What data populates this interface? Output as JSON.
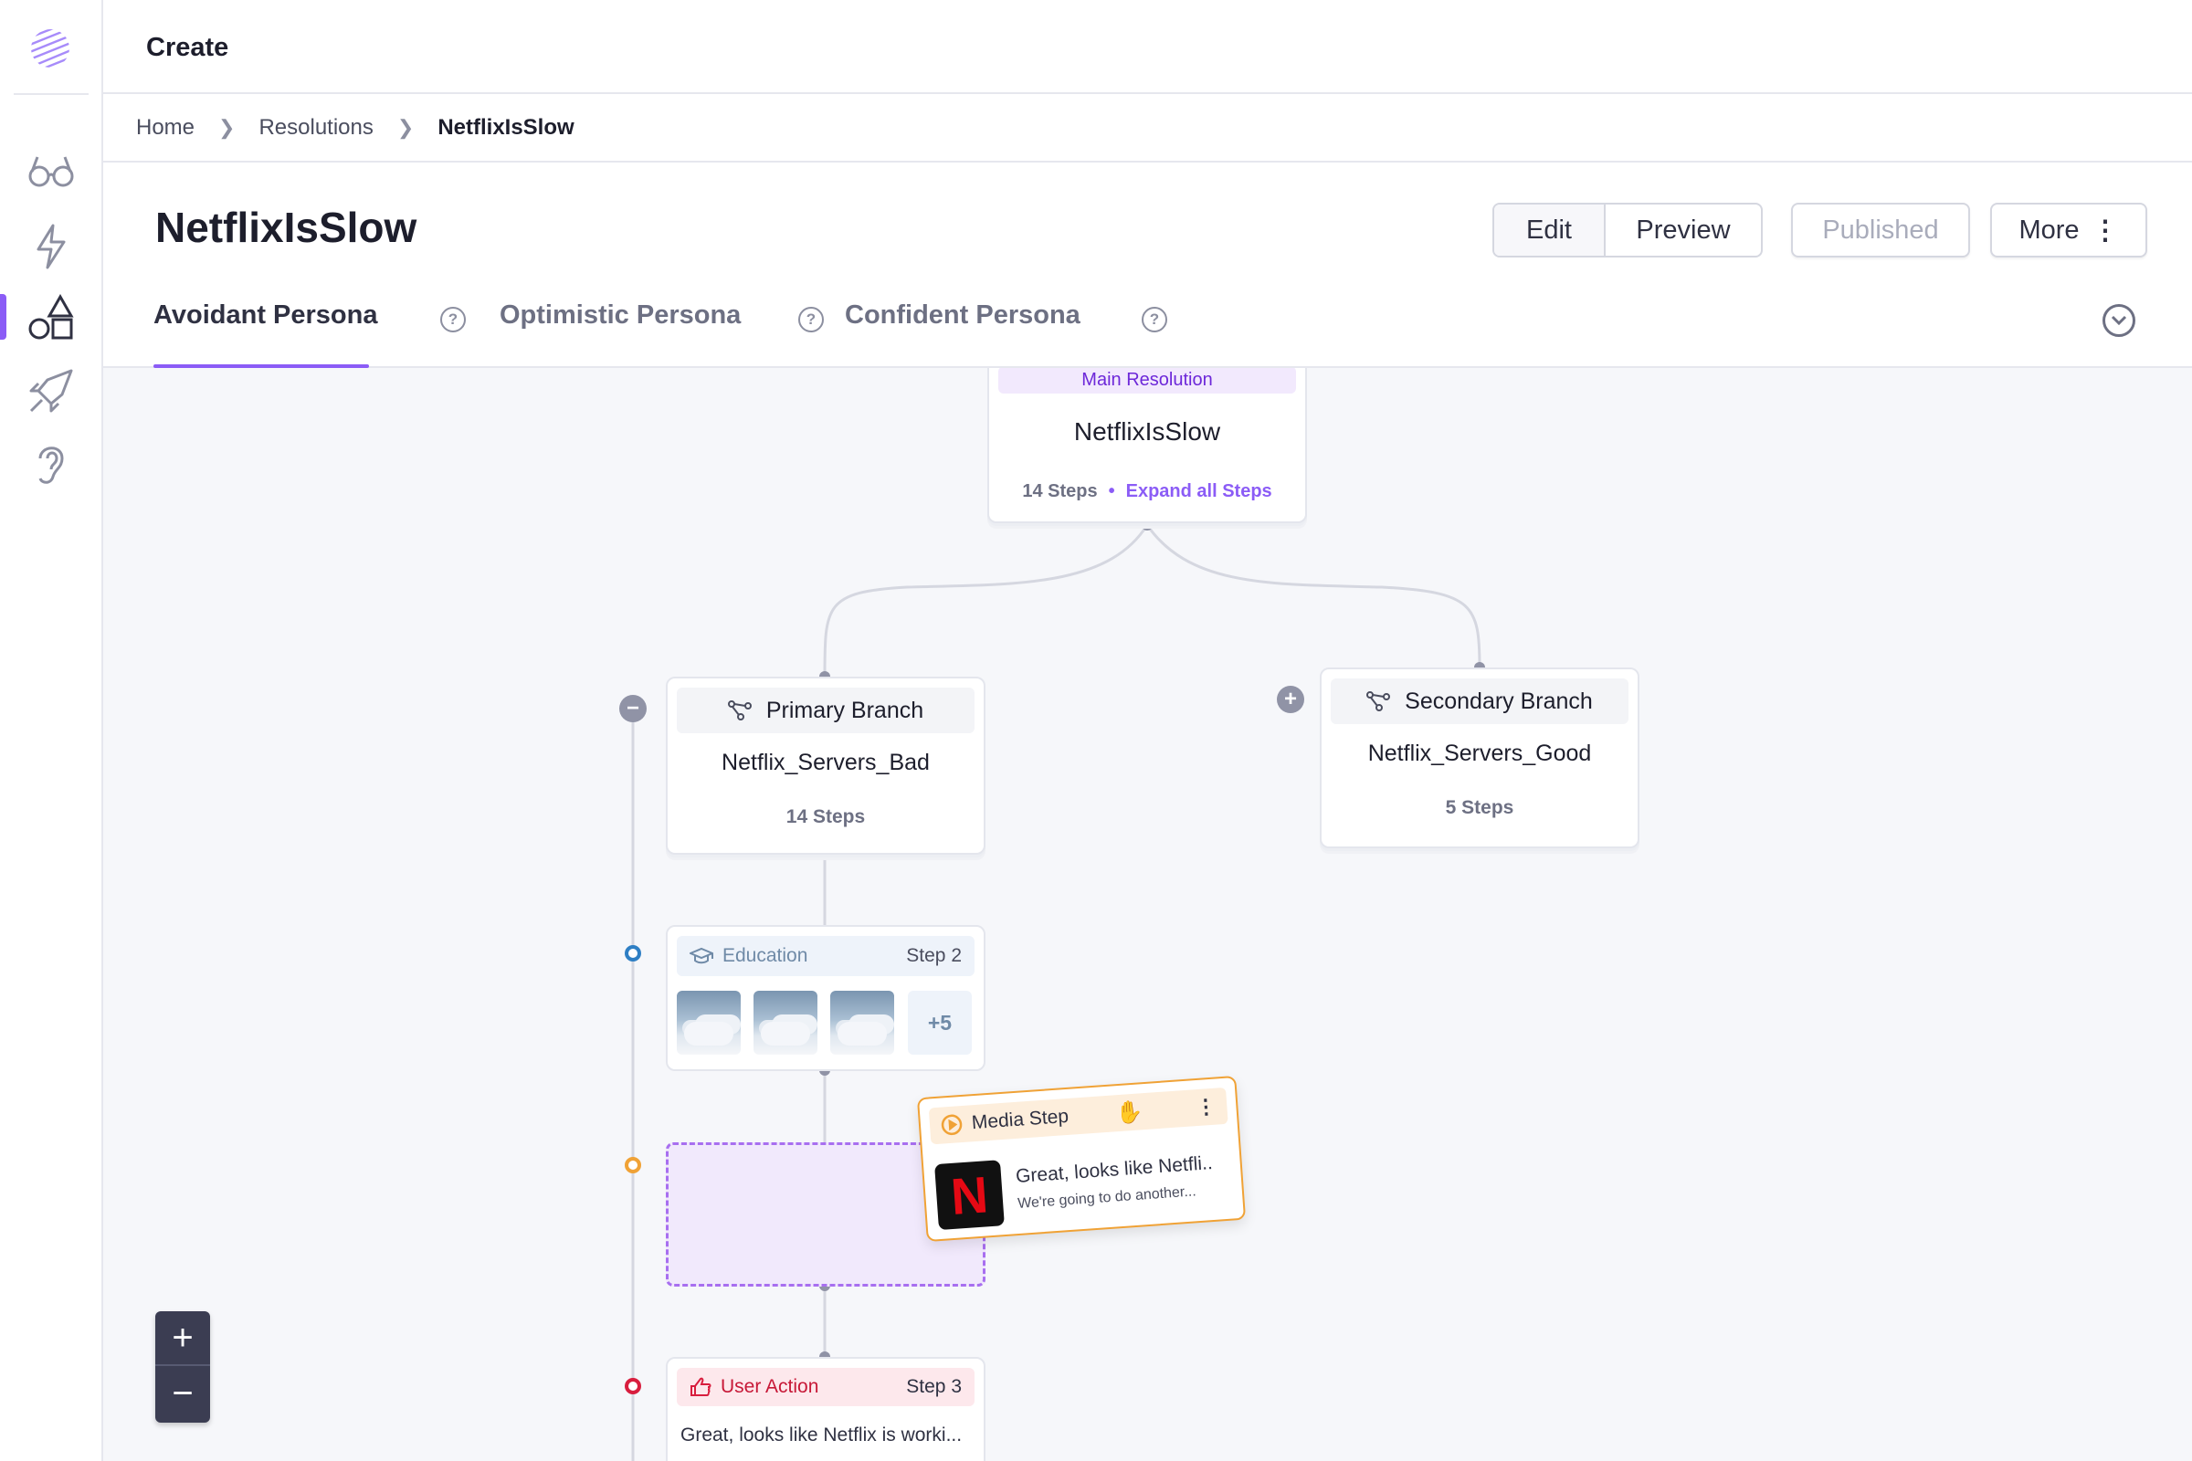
{
  "app": {
    "section_title": "Create"
  },
  "breadcrumb": {
    "items": [
      "Home",
      "Resolutions"
    ],
    "current": "NetflixIsSlow"
  },
  "page": {
    "title": "NetflixIsSlow",
    "buttons": {
      "edit": "Edit",
      "preview": "Preview",
      "published": "Published",
      "more": "More"
    },
    "tabs": [
      "Avoidant Persona",
      "Optimistic Persona",
      "Confident Persona"
    ],
    "active_tab": "Avoidant Persona"
  },
  "canvas": {
    "main_node": {
      "label": "Main Resolution",
      "name": "NetflixIsSlow",
      "steps": "14 Steps",
      "expand": "Expand all Steps"
    },
    "primary_branch": {
      "label": "Primary Branch",
      "name": "Netflix_Servers_Bad",
      "steps": "14 Steps"
    },
    "secondary_branch": {
      "label": "Secondary Branch",
      "name": "Netflix_Servers_Good",
      "steps": "5 Steps"
    },
    "education_step": {
      "label": "Education",
      "step": "Step 2",
      "more": "+5"
    },
    "media_step": {
      "label": "Media Step",
      "title": "Great, looks like Netfli..",
      "subtitle": "We're going to do another...",
      "thumb_letter": "N"
    },
    "user_action_step": {
      "label": "User Action",
      "step": "Step 3",
      "text": "Great, looks like Netflix is worki..."
    },
    "zoom": {
      "in": "+",
      "out": "−"
    }
  },
  "colors": {
    "accent": "#8b5cf6",
    "education": "#2f7fc4",
    "media": "#f0a236",
    "user_action": "#d81e3e"
  }
}
